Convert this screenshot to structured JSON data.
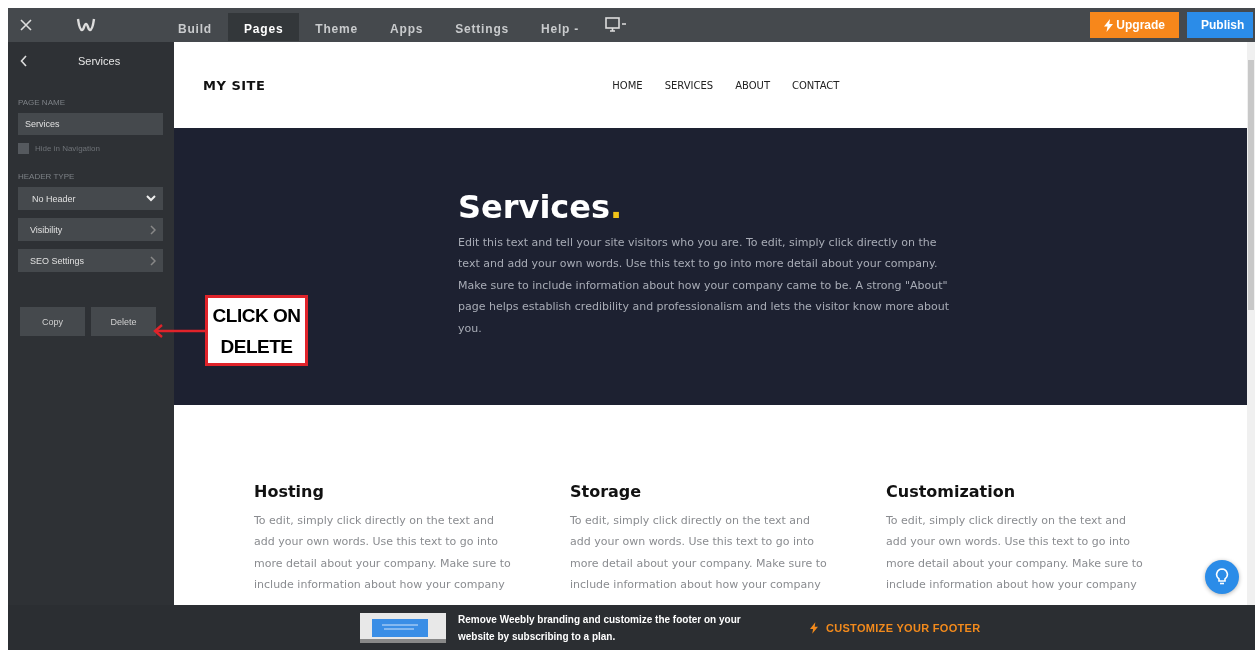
{
  "topbar": {
    "tabs": [
      {
        "label": "Build",
        "selected": false
      },
      {
        "label": "Pages",
        "selected": true
      },
      {
        "label": "Theme",
        "selected": false
      },
      {
        "label": "Apps",
        "selected": false
      },
      {
        "label": "Settings",
        "selected": false
      },
      {
        "label": "Help -",
        "selected": false
      }
    ],
    "upgrade_button": "Upgrade",
    "publish_button": "Publish"
  },
  "sidebar": {
    "title": "Services",
    "page_name_label": "PAGE NAME",
    "page_name_value": "Services",
    "hide_in_navigation": {
      "label": "Hide in Navigation",
      "checked": false
    },
    "header_type_label": "HEADER TYPE",
    "header_type_value": "No Header",
    "items": [
      "Visibility",
      "SEO Settings"
    ],
    "buttons": [
      "Copy",
      "Delete"
    ]
  },
  "annotation": "CLICK ON DELETE",
  "site": {
    "logo": "MY SITE",
    "nav": [
      "HOME",
      "SERVICES",
      "ABOUT",
      "CONTACT"
    ],
    "hero": {
      "title": "Services",
      "title_accent": ".",
      "text": "Edit this text and tell your site visitors who you are. To edit, simply click directly on the text and add your own words. Use this text to go into more detail about your company. Make sure to include information about how your company came to be. A strong \"About\" page helps establish credibility and professionalism and lets the visitor know more about you."
    },
    "columns": [
      {
        "heading": "Hosting",
        "text": "To edit, simply click directly on the text and add your own words. Use this text to go into more detail about your company. Make sure to include information about how your company"
      },
      {
        "heading": "Storage",
        "text": "To edit, simply click directly on the text and add your own words. Use this text to go into more detail about your company. Make sure to include information about how your company"
      },
      {
        "heading": "Customization",
        "text": "To edit, simply click directly on the text and add your own words. Use this text to go into more detail about your company. Make sure to include information about how your company"
      }
    ]
  },
  "footer_banner": {
    "text": "Remove Weebly branding and customize the footer on your website by subscribing to a plan.",
    "link": "CUSTOMIZE YOUR FOOTER"
  }
}
